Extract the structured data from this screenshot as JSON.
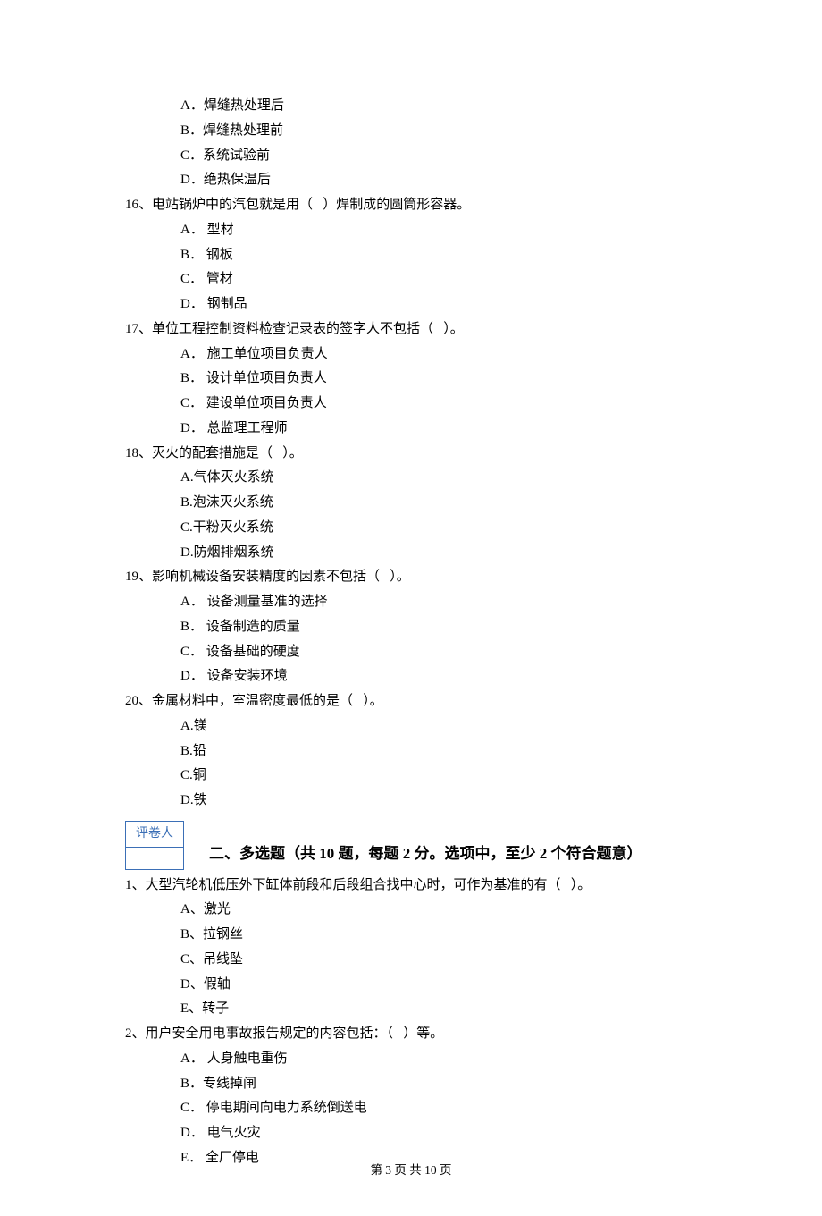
{
  "q15_tail": {
    "options": [
      "A．焊缝热处理后",
      "B．焊缝热处理前",
      "C．系统试验前",
      "D．绝热保温后"
    ]
  },
  "q16": {
    "stem": "16、电站锅炉中的汽包就是用（   ）焊制成的圆筒形容器。",
    "options": [
      "A． 型材",
      "B． 钢板",
      "C． 管材",
      "D． 钢制品"
    ]
  },
  "q17": {
    "stem": "17、单位工程控制资料检查记录表的签字人不包括（   ）。",
    "options": [
      "A． 施工单位项目负责人",
      "B． 设计单位项目负责人",
      "C． 建设单位项目负责人",
      "D． 总监理工程师"
    ]
  },
  "q18": {
    "stem": "18、灭火的配套措施是（   ）。",
    "options": [
      "A.气体灭火系统",
      "B.泡沫灭火系统",
      "C.干粉灭火系统",
      "D.防烟排烟系统"
    ]
  },
  "q19": {
    "stem": "19、影响机械设备安装精度的因素不包括（   ）。",
    "options": [
      "A． 设备测量基准的选择",
      "B． 设备制造的质量",
      "C． 设备基础的硬度",
      "D． 设备安装环境"
    ]
  },
  "q20": {
    "stem": "20、金属材料中，室温密度最低的是（   ）。",
    "options": [
      "A.镁",
      "B.铅",
      "C.铜",
      "D.铁"
    ]
  },
  "section2": {
    "grader_label": "评卷人",
    "title": "二、多选题（共 10 题，每题 2 分。选项中，至少 2 个符合题意）"
  },
  "m1": {
    "stem": "1、大型汽轮机低压外下缸体前段和后段组合找中心时，可作为基准的有（   ）。",
    "options": [
      "A、激光",
      "B、拉钢丝",
      "C、吊线坠",
      "D、假轴",
      "E、转子"
    ]
  },
  "m2": {
    "stem": "2、用户安全用电事故报告规定的内容包括：（   ）等。",
    "options": [
      "A． 人身触电重伤",
      "B．专线掉闸",
      "C． 停电期间向电力系统倒送电",
      "D． 电气火灾",
      "E． 全厂停电"
    ]
  },
  "footer": "第 3 页 共 10 页"
}
